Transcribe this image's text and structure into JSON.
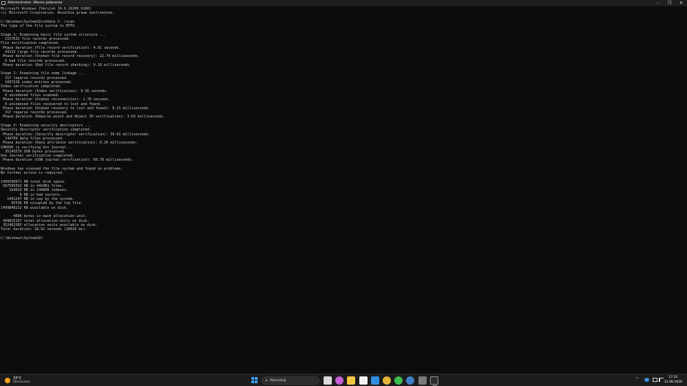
{
  "window": {
    "title": "Administrator: Wiersz polecenia",
    "controls": {
      "minimize": "–",
      "maximize": "❐",
      "close": "✕"
    }
  },
  "console": {
    "lines": [
      "Microsoft Windows [Version 10.0.26200.9168]",
      "(c) Microsoft Corporation. Wszelkie prawa zastrzeżone.",
      "",
      "C:\\Windows\\System32>chkdsk C: /scan",
      "The type of the file system is NTFS.",
      "",
      "Stage 1: Examining basic file system structure ...",
      "  1157632 file records processed.",
      "File verification completed.",
      " Phase duration (File record verification): 4.61 seconds.",
      "  43113 large file records processed.",
      " Phase duration (Orphan file record recovery): 22.74 milliseconds.",
      "  0 bad file records processed.",
      " Phase duration (Bad file record checking): 0.16 milliseconds.",
      "",
      "Stage 2: Examining file name linkage ...",
      "  317 reparse records processed.",
      "  1607228 index entries processed.",
      "Index verification completed.",
      " Phase duration (Index verification): 9.56 seconds.",
      "  0 unindexed files scanned.",
      " Phase duration (Orphan reconnection): 1.70 seconds.",
      "  0 unindexed files recovered to lost and found.",
      " Phase duration (Orphan recovery to lost and found): 0.21 milliseconds.",
      "  317 reparse records processed.",
      " Phase duration (Reparse point and Object ID verification): 3.63 milliseconds.",
      "",
      "Stage 3: Examining security descriptors ...",
      "Security descriptor verification completed.",
      " Phase duration (Security descriptor verification): 39.91 milliseconds.",
      "  144799 data files processed.",
      " Phase duration (Data attribute verification): 0.26 milliseconds.",
      "CHKDSK is verifying Usn Journal...",
      "  35143576 USN bytes processed.",
      "Usn Journal verification completed.",
      " Phase duration (USN journal verification): 69.78 milliseconds.",
      "",
      "Windows has scanned the file system and found no problems.",
      "No further action is required.",
      "",
      "1999260671 KB total disk space.",
      " 587595592 KB in 442481 files.",
      "    324620 KB in 144800 indexes.",
      "         0 KB in bad sectors.",
      "   1491247 KB in use by the system.",
      "     65536 KB occupied by the log file.",
      "1409849212 KB available on disk.",
      "",
      "      4096 bytes in each allocation unit.",
      " 499815167 total allocation units on disk.",
      " 352462303 allocation units available on disk.",
      "Total duration: 18.02 seconds (18029 ms).",
      "",
      "C:\\Windows\\System32>"
    ]
  },
  "taskbar": {
    "weather": {
      "temperature": "33°C",
      "condition": "Słonecznie"
    },
    "search": {
      "placeholder": "Wyszukaj"
    },
    "apps": [
      {
        "icon": "task-view-icon",
        "color": "#d9d9d9"
      },
      {
        "icon": "copilot-icon",
        "color": "#c95fd6"
      },
      {
        "icon": "file-explorer-icon",
        "color": "#f4c542"
      },
      {
        "icon": "microsoft-store-icon",
        "color": "#f2f2f2"
      },
      {
        "icon": "mail-icon",
        "color": "#2e8fe0"
      },
      {
        "icon": "chrome-icon",
        "color": "#e5b43a"
      },
      {
        "icon": "xbox-icon",
        "color": "#3cbf4a"
      },
      {
        "icon": "steam-icon",
        "color": "#3f7fc6"
      },
      {
        "icon": "app-icon",
        "color": "#7a7a7a"
      },
      {
        "icon": "terminal-icon",
        "color": "#2b2b2b"
      }
    ],
    "tray": {
      "chevron": "^",
      "clock": {
        "time": "17:22",
        "date": "12.08.2026"
      }
    }
  }
}
